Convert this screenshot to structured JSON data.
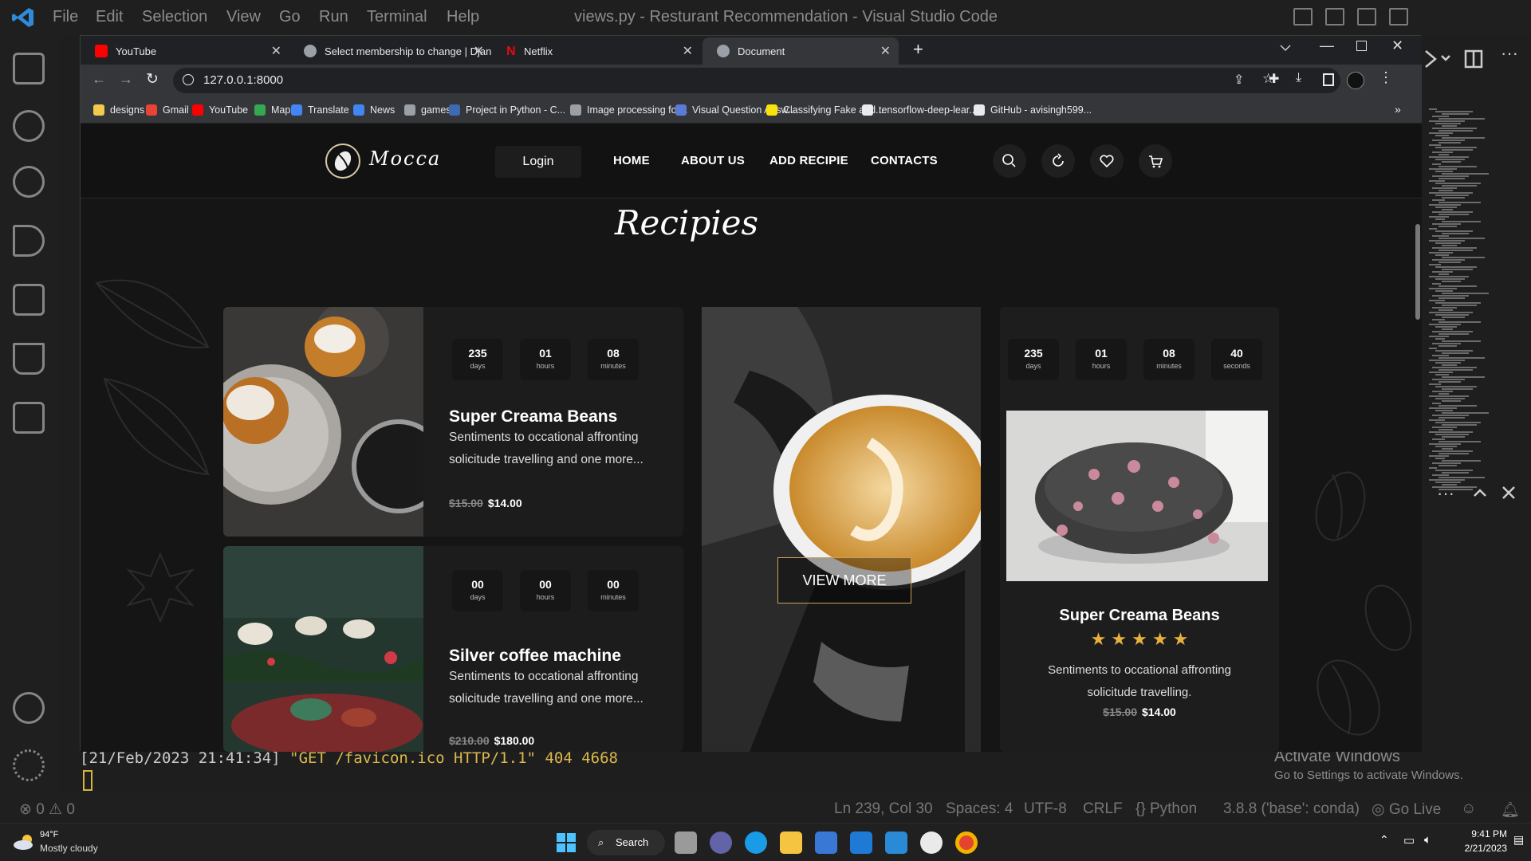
{
  "vscode": {
    "menu": [
      "File",
      "Edit",
      "Selection",
      "View",
      "Go",
      "Run",
      "Terminal",
      "Help"
    ],
    "title": "views.py - Resturant Recommendation - Visual Studio Code",
    "terminal_line_prefix": "[21/Feb/2023 21:41:34]",
    "terminal_line_request": "\"GET /favicon.ico HTTP/1.1\"",
    "terminal_line_status": "404 4668",
    "status": {
      "errors": "0",
      "warnings": "0",
      "cursor": "Ln 239, Col 30",
      "spaces": "Spaces: 4",
      "encoding": "UTF-8",
      "eol": "CRLF",
      "language": "Python",
      "interpreter": "3.8.8 ('base': conda)",
      "golive": "Go Live"
    },
    "watermark_title": "Activate Windows",
    "watermark_sub": "Go to Settings to activate Windows."
  },
  "browser": {
    "tabs": [
      {
        "title": "YouTube",
        "color": "#ff0000"
      },
      {
        "title": "Select membership to change | Djan",
        "color": "#9aa0a6"
      },
      {
        "title": "Netflix",
        "color": "#e50914"
      },
      {
        "title": "Document",
        "color": "#9aa0a6"
      }
    ],
    "url": "127.0.0.1:8000",
    "bookmarks": [
      {
        "label": "designs",
        "color": "#f2c94c"
      },
      {
        "label": "Gmail",
        "color": "#ea4335"
      },
      {
        "label": "YouTube",
        "color": "#ff0000"
      },
      {
        "label": "Maps",
        "color": "#34a853"
      },
      {
        "label": "Translate",
        "color": "#4285f4"
      },
      {
        "label": "News",
        "color": "#4285f4"
      },
      {
        "label": "games",
        "color": "#9aa0a6"
      },
      {
        "label": "Project in Python - C...",
        "color": "#3d6ab3"
      },
      {
        "label": "Image processing for...",
        "color": "#9aa0a6"
      },
      {
        "label": "Visual Question Answ...",
        "color": "#5b7bd5"
      },
      {
        "label": "Classifying Fake and...",
        "color": "#f7e20a"
      },
      {
        "label": "tensorflow-deep-lear...",
        "color": "#e8eaed"
      },
      {
        "label": "GitHub - avisingh599...",
        "color": "#e8eaed"
      }
    ],
    "more": "»"
  },
  "site": {
    "brand": "Mocca",
    "login": "Login",
    "nav": [
      "HOME",
      "ABOUT US",
      "ADD RECIPIE",
      "CONTACTS"
    ],
    "heading": "Recipies",
    "cards": [
      {
        "countdown": [
          {
            "v": "235",
            "u": "days"
          },
          {
            "v": "01",
            "u": "hours"
          },
          {
            "v": "08",
            "u": "minutes"
          }
        ],
        "title": "Super Creama Beans",
        "desc1": "Sentiments to occational affronting",
        "desc2": "solicitude travelling and one more...",
        "old_price": "$15.00",
        "price": "$14.00"
      },
      {
        "countdown": [
          {
            "v": "00",
            "u": "days"
          },
          {
            "v": "00",
            "u": "hours"
          },
          {
            "v": "00",
            "u": "minutes"
          }
        ],
        "title": "Silver coffee machine",
        "desc1": "Sentiments to occational affronting",
        "desc2": "solicitude travelling and one more...",
        "old_price": "$210.00",
        "price": "$180.00"
      }
    ],
    "view_more": "VIEW MORE",
    "feature": {
      "countdown": [
        {
          "v": "235",
          "u": "days"
        },
        {
          "v": "01",
          "u": "hours"
        },
        {
          "v": "08",
          "u": "minutes"
        },
        {
          "v": "40",
          "u": "seconds"
        }
      ],
      "title": "Super Creama Beans",
      "rating": 5,
      "desc1": "Sentiments to occational affronting",
      "desc2": "solicitude travelling.",
      "old_price": "$15.00",
      "price": "$14.00"
    }
  },
  "taskbar": {
    "temp": "94°F",
    "weather": "Mostly cloudy",
    "search": "Search",
    "time": "9:41 PM",
    "date": "2/21/2023"
  }
}
